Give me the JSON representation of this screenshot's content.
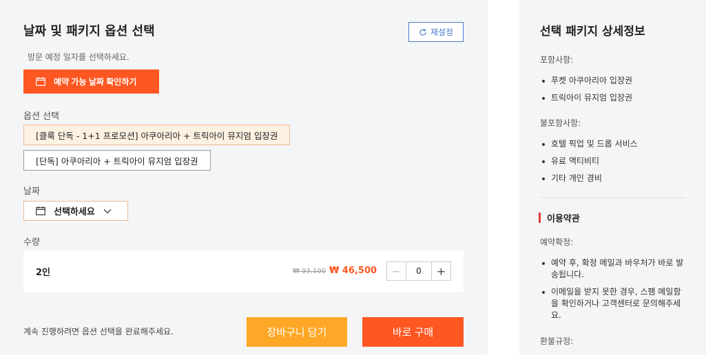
{
  "left": {
    "title": "날짜 및 패키지 옵션 선택",
    "reset_label": "재설정",
    "visit_hint": "방문 예정 일자를 선택하세요.",
    "date_check_label": "예약 가능 날짜 확인하기",
    "option_label": "옵션 선택",
    "options": [
      "[클룩 단독 - 1+1 프로모션] 아쿠아리아 + 트릭아이 뮤지엄 입장권",
      "[단독] 아쿠아리아 + 트릭아이 뮤지엄 입장권"
    ],
    "date_label": "날짜",
    "date_select_value": "선택하세요",
    "quantity_label": "수량",
    "quantity": {
      "unit_label": "2인",
      "old_price": "₩ 93,100",
      "new_price": "₩ 46,500",
      "value": "0",
      "minus": "−",
      "plus": "+"
    },
    "footer_note": "계속 진행하려면 옵션 선택을 완료해주세요.",
    "cart_label": "장바구니 담기",
    "buy_label": "바로 구매"
  },
  "right": {
    "title": "선택 패키지 상세정보",
    "included_label": "포함사항:",
    "included": [
      "푸켓 아쿠아리아 입장권",
      "트릭아이 뮤지엄 입장권"
    ],
    "excluded_label": "불포함사항:",
    "excluded": [
      "호텔 픽업 및 드롭 서비스",
      "유료 액티비티",
      "기타 개인 경비"
    ],
    "terms_title": "이용약관",
    "confirm_label": "예약확정:",
    "confirm_items": [
      "예약 후, 확정 메일과 바우처가 바로 발송됩니다.",
      "이메일을 받지 못한 경우, 스팸 메일함을 확인하거나 고객센터로 문의해주세요."
    ],
    "refund_label": "환불규정:"
  },
  "colors": {
    "accent": "#ff5722",
    "cart": "#ffa726",
    "link": "#4a78c9",
    "terms_bar": "#e53935"
  },
  "icons": [
    "refresh-icon",
    "calendar-icon",
    "chevron-down-icon"
  ]
}
